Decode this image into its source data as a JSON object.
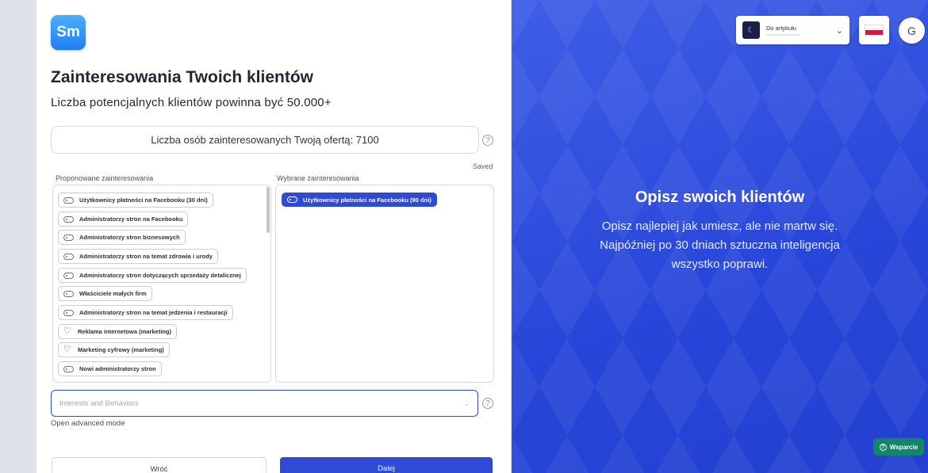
{
  "logo": {
    "text": "Sm"
  },
  "header": {
    "title": "Zainteresowania Twoich klientów",
    "subtitle": "Liczba potencjalnych klientów powinna być 50.000+"
  },
  "audience": {
    "label": "Liczba osób zainteresowanych Twoją ofertą: 7100"
  },
  "help_icon": "?",
  "saved_label": "Saved",
  "proposed": {
    "label": "Proponowane zainteresowania",
    "items": [
      {
        "label": "Użytkownicy płatności na Facebooku (30 dni)",
        "icon": "toggle-icon"
      },
      {
        "label": "Administratorzy stron na Facebooku",
        "icon": "toggle-icon"
      },
      {
        "label": "Administratorzy stron biznesowych",
        "icon": "toggle-icon"
      },
      {
        "label": "Administratorzy stron na temat zdrowia i urody",
        "icon": "toggle-icon"
      },
      {
        "label": "Administratorzy stron dotyczących sprzedaży detalicznej",
        "icon": "toggle-icon"
      },
      {
        "label": "Właściciele małych firm",
        "icon": "toggle-icon"
      },
      {
        "label": "Administratorzy stron na temat jedzenia i restauracji",
        "icon": "toggle-icon"
      },
      {
        "label": "Reklama internetowa (marketing)",
        "icon": "heart-icon"
      },
      {
        "label": "Marketing cyfrowy (marketing)",
        "icon": "heart-icon"
      },
      {
        "label": "Nowi administratorzy stron",
        "icon": "toggle-icon"
      }
    ]
  },
  "selected": {
    "label": "Wybrane zainteresowania",
    "items": [
      {
        "label": "Użytkownicy płatności na Facebooku (90 dni)",
        "icon": "toggle-icon"
      }
    ]
  },
  "search": {
    "placeholder": "Interests and Behaviors",
    "value": ""
  },
  "advanced_mode": "Open advanced mode",
  "buttons": {
    "back": "Wróć",
    "next": "Dalej"
  },
  "right_panel": {
    "selector_label": "Do artykułu",
    "title": "Opisz swoich klientów",
    "description": "Opisz najlepiej jak umiesz, ale nie martw się. Najpóźniej po 30 dniach sztuczna inteligencja wszystko poprawi.",
    "support_label": "Wsparcie"
  },
  "colors": {
    "accent": "#2f4ad4",
    "panel_bg": "#2746d9",
    "support_bg": "#12856b"
  }
}
